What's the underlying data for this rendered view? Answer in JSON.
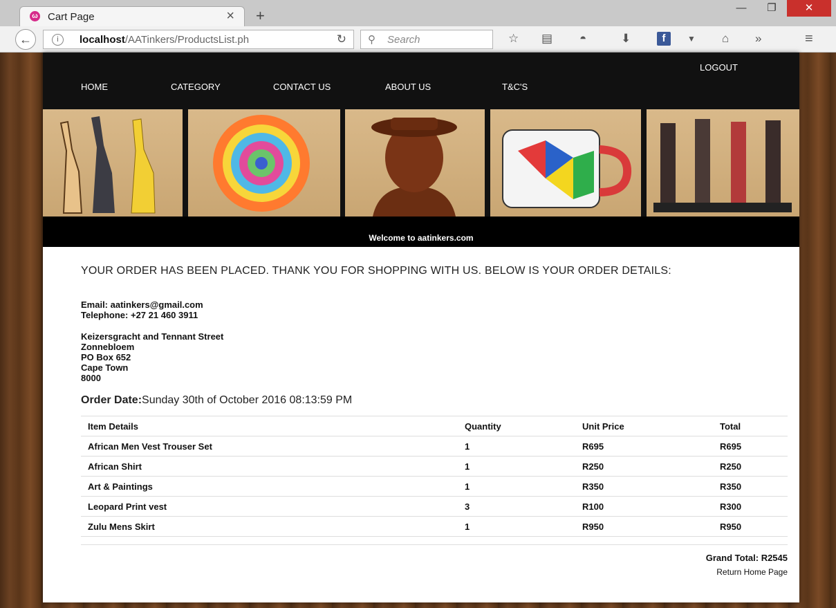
{
  "browser": {
    "tab_title": "Cart Page",
    "url_host": "localhost",
    "url_path": "/AATinkers/ProductsList.ph",
    "search_placeholder": "Search"
  },
  "site": {
    "logout_label": "LOGOUT",
    "nav": [
      {
        "label": "HOME"
      },
      {
        "label": "CATEGORY"
      },
      {
        "label": "CONTACT US"
      },
      {
        "label": "ABOUT US"
      },
      {
        "label": "T&C'S"
      }
    ],
    "welcome": "Welcome to aatinkers.com"
  },
  "order": {
    "confirmation": "YOUR ORDER HAS BEEN PLACED. THANK YOU FOR SHOPPING WITH US. BELOW IS YOUR ORDER DETAILS:",
    "email": "Email: aatinkers@gmail.com",
    "telephone": "Telephone: +27 21 460 3911",
    "address": [
      "Keizersgracht and Tennant Street",
      "Zonnebloem",
      "PO Box 652",
      "Cape Town",
      "8000"
    ],
    "date_label": "Order Date:",
    "date_value": "Sunday 30th of October 2016 08:13:59 PM",
    "columns": [
      "Item Details",
      "Quantity",
      "Unit Price",
      "Total"
    ],
    "items": [
      {
        "name": "African Men Vest Trouser Set",
        "qty": "1",
        "price": "R695",
        "total": "R695"
      },
      {
        "name": "African Shirt",
        "qty": "1",
        "price": "R250",
        "total": "R250"
      },
      {
        "name": "Art & Paintings",
        "qty": "1",
        "price": "R350",
        "total": "R350"
      },
      {
        "name": "Leopard Print vest",
        "qty": "3",
        "price": "R100",
        "total": "R300"
      },
      {
        "name": "Zulu Mens Skirt",
        "qty": "1",
        "price": "R950",
        "total": "R950"
      }
    ],
    "grand_total": "Grand Total: R2545",
    "return_link": "Return Home Page"
  }
}
